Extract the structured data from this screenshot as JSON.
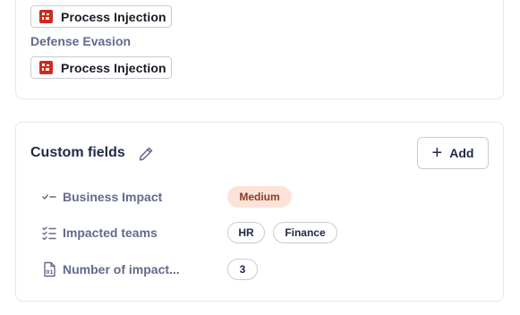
{
  "techniques": {
    "first_tag": "Process Injection",
    "section_label": "Defense Evasion",
    "second_tag": "Process Injection"
  },
  "custom_fields": {
    "title": "Custom fields",
    "add_label": "Add",
    "rows": [
      {
        "label": "Business Impact",
        "values": [
          "Medium"
        ]
      },
      {
        "label": "Impacted teams",
        "values": [
          "HR",
          "Finance"
        ]
      },
      {
        "label": "Number of impact...",
        "values": [
          "3"
        ]
      }
    ]
  },
  "colors": {
    "brand_red": "#d2291d",
    "medium_pill_bg": "#fce3da",
    "medium_pill_text": "#8a3b22"
  }
}
